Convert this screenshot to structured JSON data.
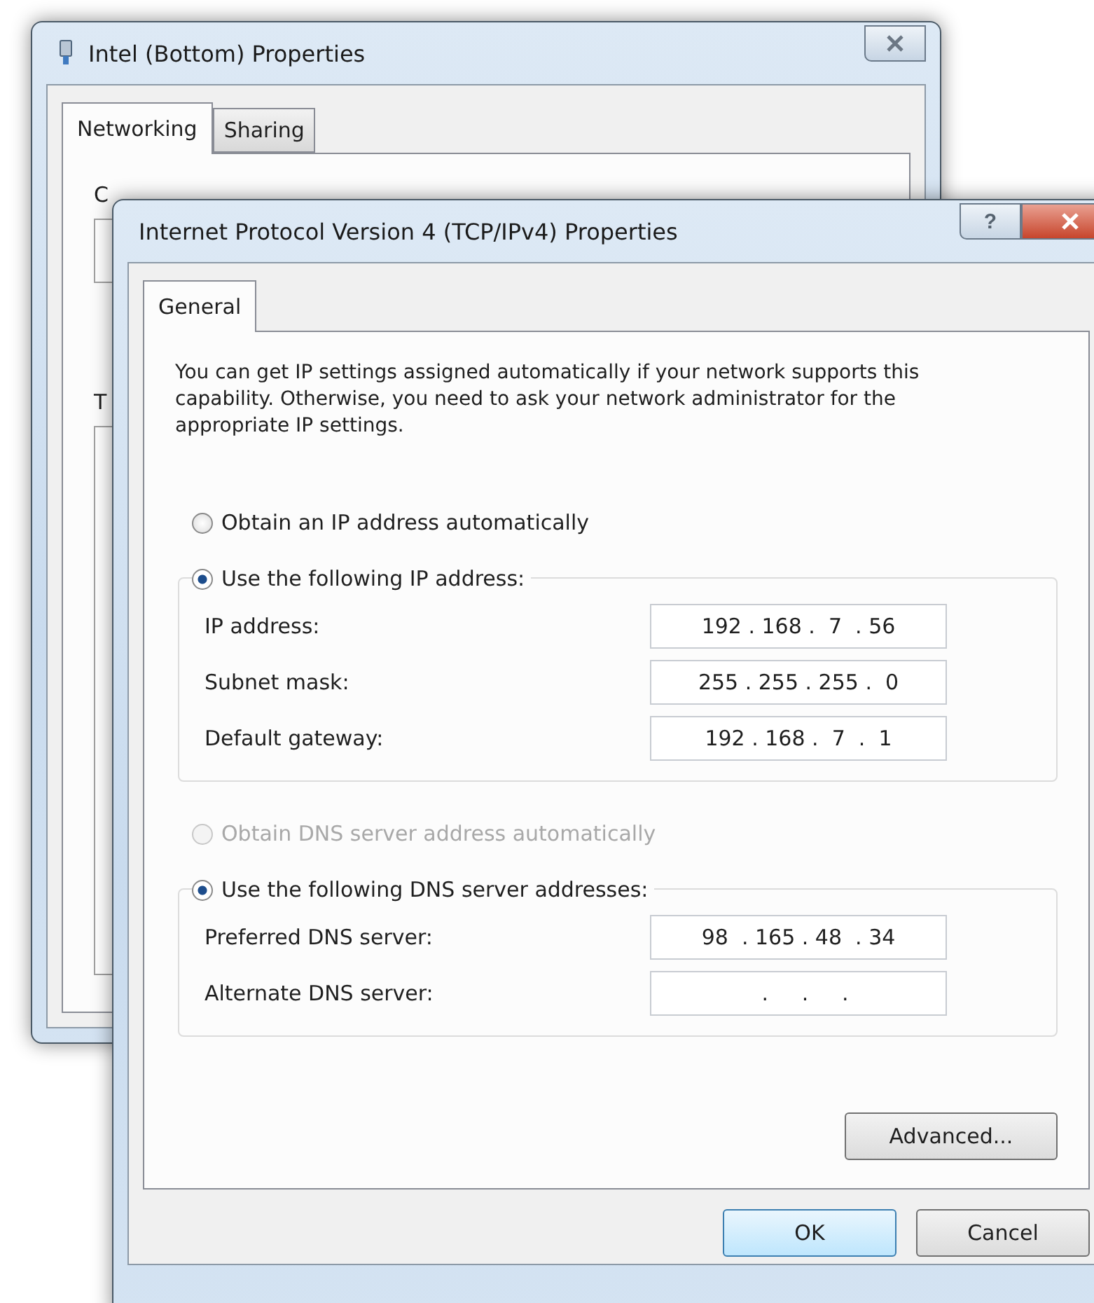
{
  "back_window": {
    "title": "Intel (Bottom) Properties",
    "tabs": [
      {
        "label": "Networking",
        "selected": true
      },
      {
        "label": "Sharing",
        "selected": false
      }
    ],
    "fragments": [
      "C",
      "T"
    ]
  },
  "window": {
    "title": "Internet Protocol Version 4 (TCP/IPv4) Properties",
    "help_button": "?",
    "tabs": [
      {
        "label": "General",
        "selected": true
      }
    ],
    "intro": "You can get IP settings assigned automatically if your network supports this capability. Otherwise, you need to ask your network administrator for the appropriate IP settings.",
    "groups": [
      {
        "auto_option": {
          "label": "Obtain an IP address automatically",
          "selected": false,
          "disabled": false
        },
        "manual_option": {
          "label": "Use the following IP address:",
          "selected": true
        },
        "fields": [
          {
            "label": "IP address:",
            "value": "192 . 168 .  7  . 56"
          },
          {
            "label": "Subnet mask:",
            "value": "255 . 255 . 255 .  0"
          },
          {
            "label": "Default gateway:",
            "value": "192 . 168 .  7  .  1"
          }
        ]
      },
      {
        "auto_option": {
          "label": "Obtain DNS server address automatically",
          "selected": false,
          "disabled": true
        },
        "manual_option": {
          "label": "Use the following DNS server addresses:",
          "selected": true
        },
        "fields": [
          {
            "label": "Preferred DNS server:",
            "value": "98  . 165 . 48  . 34"
          },
          {
            "label": "Alternate DNS server:",
            "value": "     .     .     .   "
          }
        ]
      }
    ],
    "advanced_button": "Advanced...",
    "buttons": [
      {
        "label": "OK",
        "default": true
      },
      {
        "label": "Cancel",
        "default": false
      }
    ]
  }
}
